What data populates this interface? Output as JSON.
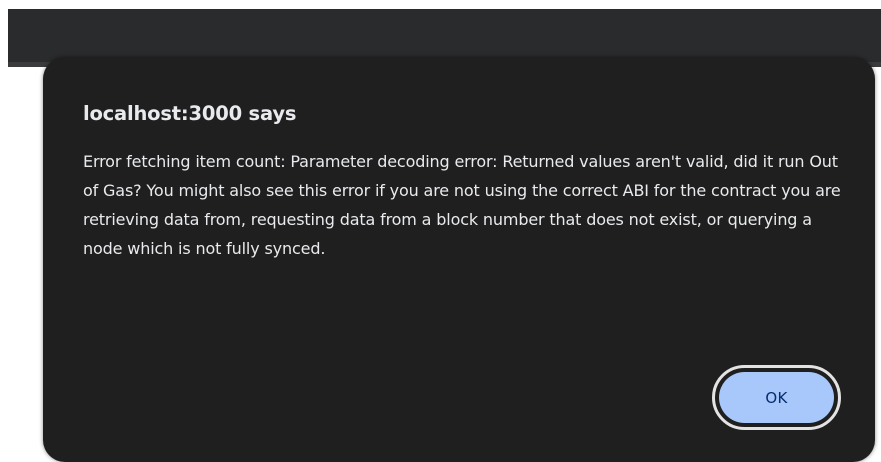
{
  "dialog": {
    "title": "localhost:3000 says",
    "message": "Error fetching item count: Parameter decoding error: Returned values aren't valid, did it run Out of Gas? You might also see this error if you are not using the correct ABI for the contract you are retrieving data from, requesting data from a block number that does not exist, or querying a node which is not fully synced.",
    "ok_label": "OK"
  },
  "colors": {
    "dialog_background": "#1f1f1f",
    "text": "#e8eaed",
    "ok_button_fill": "#a8c7fa",
    "ok_button_text": "#062e6f",
    "browser_bar": "#2a2b2d"
  }
}
